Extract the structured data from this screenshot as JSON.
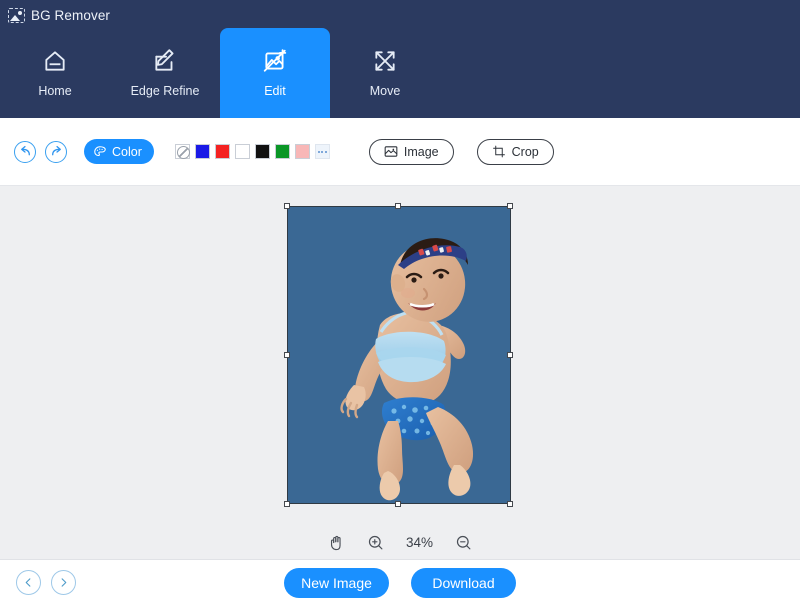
{
  "app": {
    "title": "BG Remover",
    "logo_icon": "image-dashed-icon"
  },
  "nav": {
    "items": [
      {
        "label": "Home",
        "icon": "home-icon",
        "active": false
      },
      {
        "label": "Edge Refine",
        "icon": "edit-square-icon",
        "active": false
      },
      {
        "label": "Edit",
        "icon": "image-edit-icon",
        "active": true
      },
      {
        "label": "Move",
        "icon": "move-arrows-icon",
        "active": false
      }
    ],
    "active_tab": "Edit"
  },
  "toolbar": {
    "undo_icon": "undo-arrow-icon",
    "redo_icon": "redo-arrow-icon",
    "color_label": "Color",
    "color_icon": "palette-icon",
    "swatches": [
      {
        "name": "transparent",
        "color": "none"
      },
      {
        "name": "blue",
        "color": "#1a1ae6"
      },
      {
        "name": "red",
        "color": "#f42222"
      },
      {
        "name": "white",
        "color": "#ffffff"
      },
      {
        "name": "black",
        "color": "#111111"
      },
      {
        "name": "green",
        "color": "#0a9626"
      },
      {
        "name": "pink",
        "color": "#f8b7b7"
      },
      {
        "name": "more",
        "color": "more"
      }
    ],
    "image_label": "Image",
    "image_icon": "picture-icon",
    "crop_label": "Crop",
    "crop_icon": "crop-icon"
  },
  "canvas": {
    "background_color": "#eeeff1",
    "artboard_color": "#3a6894",
    "selection_handles": 8,
    "zoom": {
      "hand_icon": "hand-icon",
      "zoom_in_icon": "zoom-in-icon",
      "zoom_out_icon": "zoom-out-icon",
      "level": "34%"
    }
  },
  "footer": {
    "prev_icon": "chevron-left-icon",
    "next_icon": "chevron-right-icon",
    "new_image_label": "New Image",
    "download_label": "Download"
  },
  "colors": {
    "header_bg": "#2b3a60",
    "accent": "#1a90ff",
    "canvas_bg": "#eeeff1",
    "artboard_bg": "#3a6894"
  }
}
